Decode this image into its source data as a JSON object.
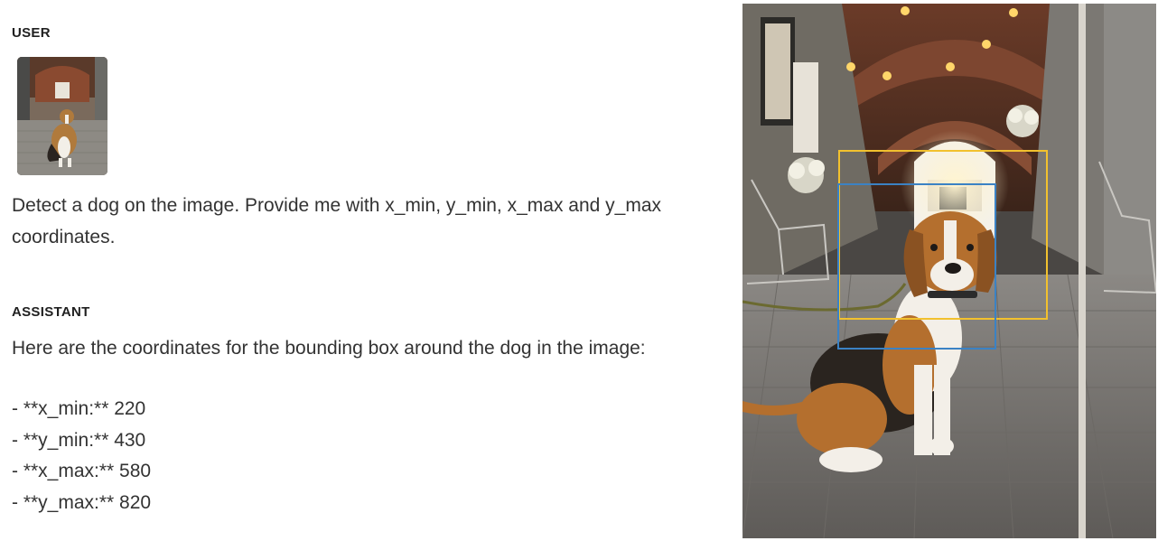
{
  "conversation": {
    "user": {
      "role_label": "USER",
      "attachment_icon": "dog-photo-thumbnail",
      "text": "Detect a dog on the image. Provide me with x_min, y_min, x_max and y_max coordinates."
    },
    "assistant": {
      "role_label": "ASSISTANT",
      "intro": "Here are the coordinates for the bounding box around the dog in the image:",
      "coordinates": [
        "- **x_min:** 220",
        "- **y_min:** 430",
        "- **x_max:** 580",
        "- **y_max:** 820"
      ]
    }
  },
  "preview": {
    "image_icon": "dog-photo",
    "box_colors": {
      "yellow": "#f2c12e",
      "blue": "#3b82c4"
    }
  }
}
